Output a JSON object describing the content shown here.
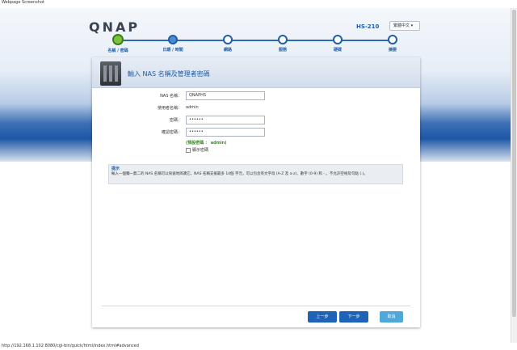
{
  "window": {
    "caption": "Webpage Screenshot"
  },
  "header": {
    "logo": "QNAP",
    "model": "HS-210",
    "language": "繁體中文 ▾"
  },
  "steps": [
    {
      "label": "名稱 / 密碼",
      "state": "current"
    },
    {
      "label": "日期 / 時間",
      "state": "done"
    },
    {
      "label": "網路",
      "state": "todo"
    },
    {
      "label": "服務",
      "state": "todo"
    },
    {
      "label": "硬碟",
      "state": "todo"
    },
    {
      "label": "摘要",
      "state": "todo"
    }
  ],
  "panel": {
    "title": "輸入 NAS 名稱及管理者密碼"
  },
  "form": {
    "nas_name_label": "NAS 名稱：",
    "nas_name_value": "QNAPHS",
    "username_label": "使用者名稱：",
    "username_value": "admin",
    "password_label": "密碼：",
    "password_value": "••••••",
    "confirm_label": "確認密碼：",
    "confirm_value": "••••••",
    "default_hint": "(預設密碼 ： admin)",
    "show_password_label": "顯示密碼"
  },
  "tip": {
    "title": "提示",
    "text": "輸入一個獨一無二的 NAS 名稱可以快速地辨識它。NAS 名稱支援最多 14個 字元，可以包含英文字母 (A-Z 及 a-z)、數字 (0-9) 和 - 。不允許空格及句點 (.)。"
  },
  "buttons": {
    "prev": "上一步",
    "next": "下一步",
    "cancel": "取消"
  },
  "status": {
    "url": "http://192.168.1.102:8080/cgi-bin/quick/html/index.html#advanced"
  }
}
